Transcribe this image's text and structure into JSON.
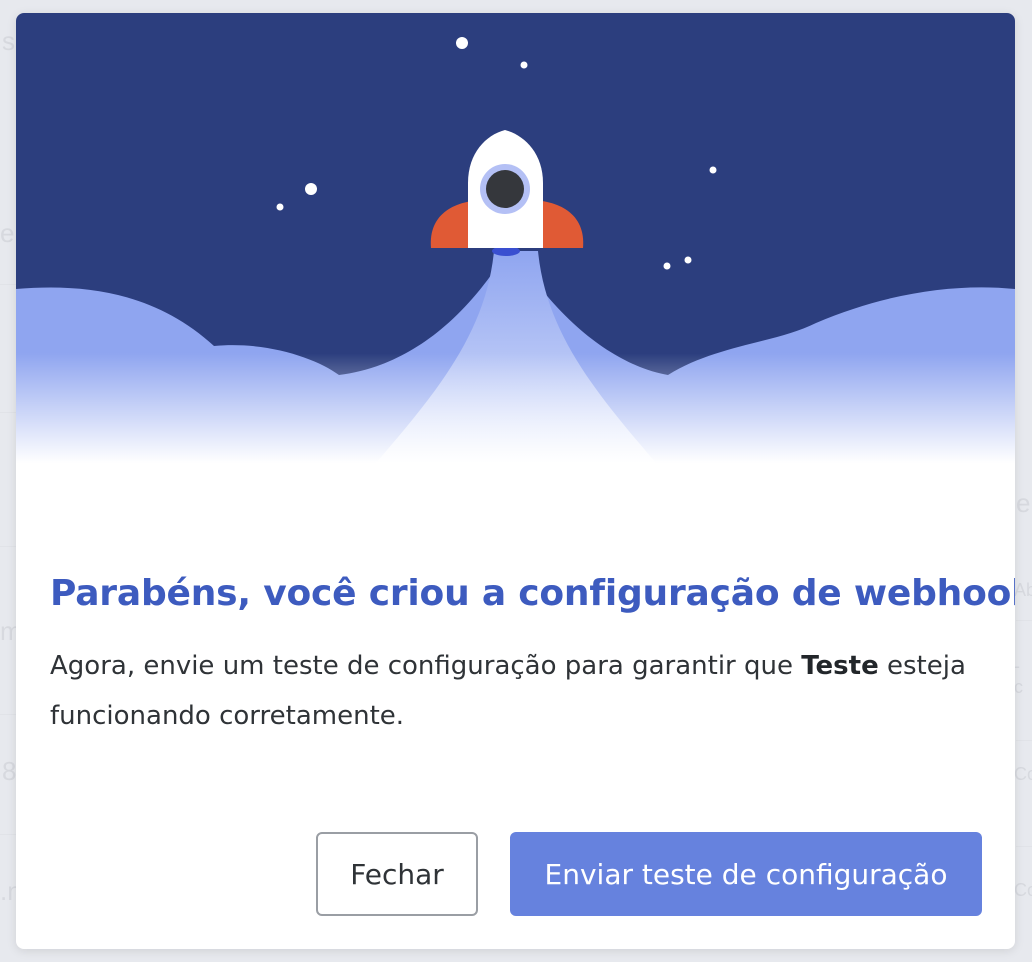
{
  "dialog": {
    "title": "Parabéns, você criou a configuração de webhook!",
    "description_before": "Agora, envie um teste de configuração para garantir que ",
    "description_bold": "Teste",
    "description_after": " esteja funcionando corretamente.",
    "close_label": "Fechar",
    "send_label": "Enviar teste de configuração"
  },
  "background_text": {
    "frag_1": "s",
    "frag_2": "e",
    "frag_3": "m",
    "frag_4": "8",
    "frag_5": ".n",
    "frag_6": "e",
    "frag_7": "Ab",
    "frag_8": "- c",
    "frag_9": "Co",
    "frag_10": "Co"
  },
  "colors": {
    "title": "#3d5bbf",
    "primary_button": "#6682de",
    "sky": "#2c3e7e",
    "clouds": "#8fa5f0",
    "rocket_fins": "#e05a35"
  },
  "icons": {
    "hero": "rocket-launch-illustration"
  }
}
